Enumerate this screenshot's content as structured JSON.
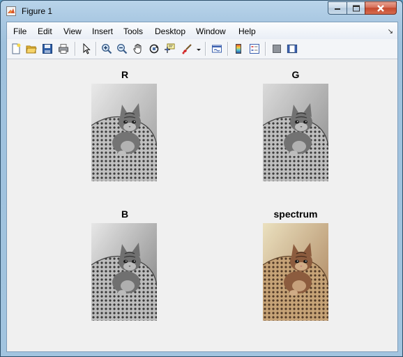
{
  "window": {
    "title": "Figure 1"
  },
  "menu": {
    "items": [
      "File",
      "Edit",
      "View",
      "Insert",
      "Tools",
      "Desktop",
      "Window",
      "Help"
    ],
    "overflow_glyph": "↘"
  },
  "toolbar": {
    "buttons": [
      "new-figure-icon",
      "open-file-icon",
      "save-icon",
      "print-icon",
      "edit-plot-arrow-icon",
      "zoom-in-icon",
      "zoom-out-icon",
      "pan-hand-icon",
      "rotate-3d-icon",
      "data-cursor-icon",
      "brush-icon",
      "link-plot-icon",
      "colorbar-icon",
      "legend-icon",
      "hide-plot-tools-icon",
      "show-plot-tools-icon"
    ]
  },
  "subplots": [
    {
      "title": "R",
      "channel": "red",
      "tint": "#9a9a9a",
      "highlight": "#f4f4f4"
    },
    {
      "title": "G",
      "channel": "green",
      "tint": "#8a8a8a",
      "highlight": "#e6e6e6"
    },
    {
      "title": "B",
      "channel": "blue",
      "tint": "#7d7d7d",
      "highlight": "#f6f6f6"
    },
    {
      "title": "spectrum",
      "channel": "rgb",
      "tint": "#a9805a",
      "highlight": "#f1e9c8"
    }
  ]
}
